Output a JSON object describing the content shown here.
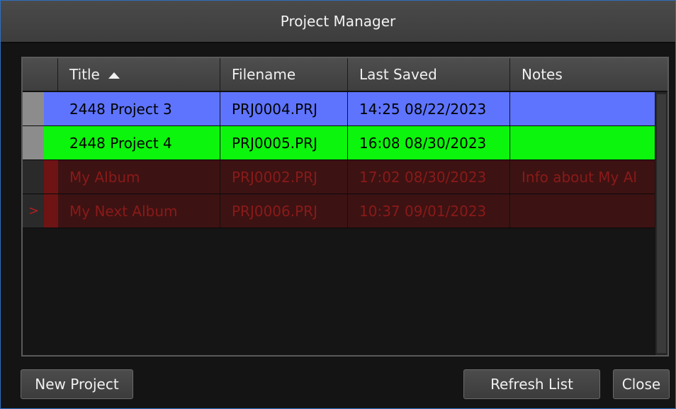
{
  "window": {
    "title": "Project Manager"
  },
  "table": {
    "columns": [
      {
        "label": "Title",
        "sorted": "ascending"
      },
      {
        "label": "Filename"
      },
      {
        "label": "Last Saved"
      },
      {
        "label": "Notes"
      }
    ],
    "rows": [
      {
        "marker": "",
        "title": "2448 Project 3",
        "filename": "PRJ0004.PRJ",
        "last_saved": "14:25 08/22/2023",
        "notes": "",
        "row_color": "#5e74ff",
        "state": "selected-blue"
      },
      {
        "marker": "",
        "title": "2448 Project 4",
        "filename": "PRJ0005.PRJ",
        "last_saved": "16:08 08/30/2023",
        "notes": "",
        "row_color": "#0cf50c",
        "state": "selected-green"
      },
      {
        "marker": "",
        "title": "My Album",
        "filename": "PRJ0002.PRJ",
        "last_saved": "17:02 08/30/2023",
        "notes": "Info about My Al",
        "row_color": "#3d1212",
        "state": "inactive"
      },
      {
        "marker": ">",
        "title": "My Next Album",
        "filename": "PRJ0006.PRJ",
        "last_saved": "10:37 09/01/2023",
        "notes": "",
        "row_color": "#3d1212",
        "state": "current"
      }
    ]
  },
  "buttons": {
    "new_project": "New Project",
    "refresh_list": "Refresh List",
    "close": "Close"
  },
  "colors": {
    "accent_border": "#2f6fc0",
    "blue_row": "#5e74ff",
    "green_row": "#0cf50c",
    "dark_row": "#3d1212",
    "dark_row_text": "#8a1a1a"
  }
}
